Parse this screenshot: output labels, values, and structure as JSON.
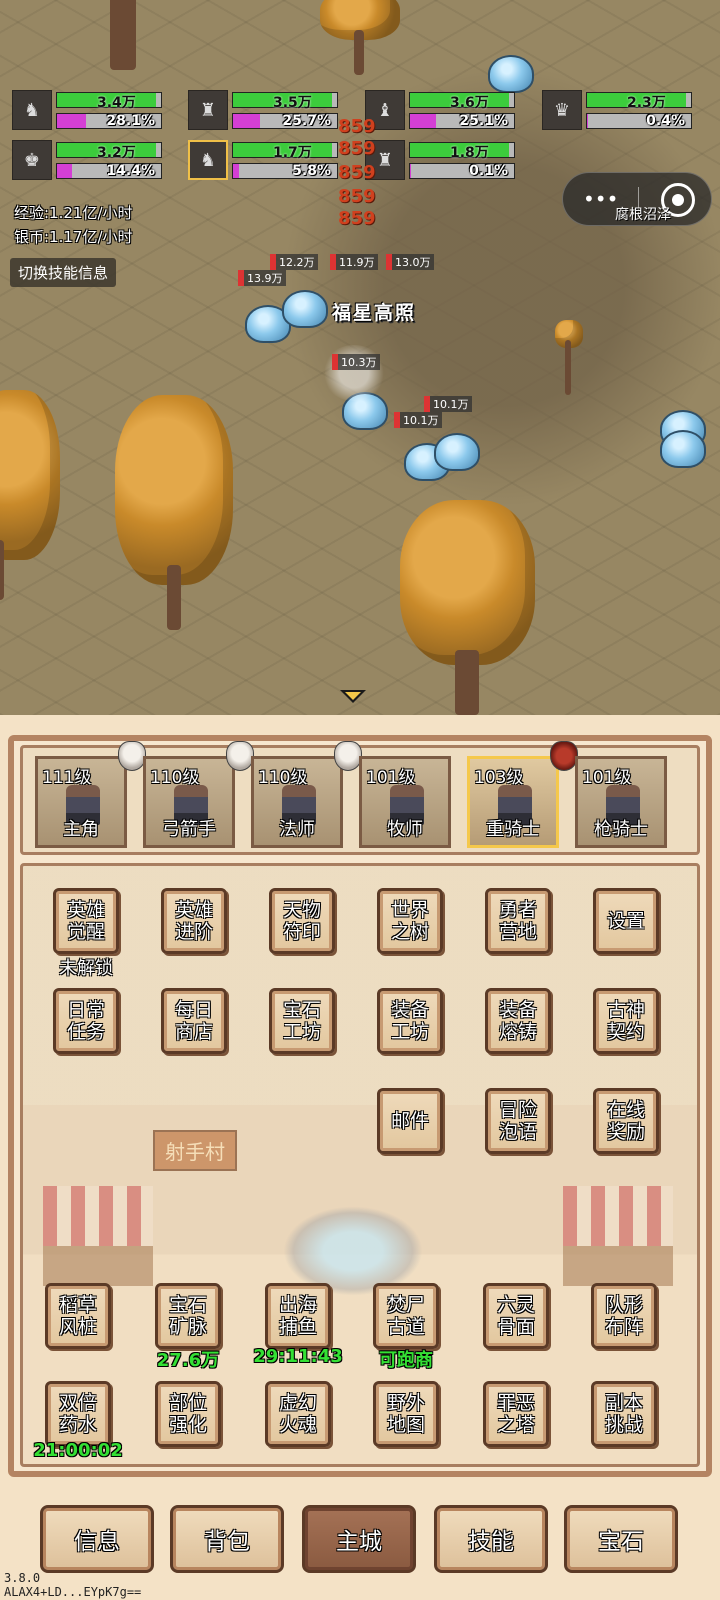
{
  "party": [
    {
      "hp": "3.4万",
      "xp": "28.1%",
      "hp_fill": 0.95,
      "xp_fill": 0.28,
      "selected": false
    },
    {
      "hp": "3.5万",
      "xp": "25.7%",
      "hp_fill": 0.95,
      "xp_fill": 0.26,
      "selected": false
    },
    {
      "hp": "3.6万",
      "xp": "25.1%",
      "hp_fill": 0.95,
      "xp_fill": 0.25,
      "selected": false
    },
    {
      "hp": "2.3万",
      "xp": "0.4%",
      "hp_fill": 0.95,
      "xp_fill": 0.01,
      "selected": false
    },
    {
      "hp": "3.2万",
      "xp": "14.4%",
      "hp_fill": 0.95,
      "xp_fill": 0.14,
      "selected": false
    },
    {
      "hp": "1.7万",
      "xp": "5.8%",
      "hp_fill": 0.95,
      "xp_fill": 0.06,
      "selected": true
    },
    {
      "hp": "1.8万",
      "xp": "0.1%",
      "hp_fill": 0.95,
      "xp_fill": 0.01,
      "selected": false
    }
  ],
  "stats": {
    "exp_rate": "经验:1.21亿/小时",
    "silver_rate": "银币:1.17亿/小时",
    "toggle_skill": "切换技能信息"
  },
  "capsule": {
    "dots": "•••",
    "map_name": "腐根沼泽"
  },
  "battle": {
    "buff_text": "福星高照",
    "crits": [
      "859",
      "859",
      "859",
      "859",
      "859"
    ],
    "damage_numbers": [
      "12.2万",
      "11.9万",
      "13.0万",
      "13.9万",
      "10.3万",
      "10.1万",
      "10.1万"
    ]
  },
  "heroes": [
    {
      "level": "111级",
      "name": "主角",
      "selected": false
    },
    {
      "level": "110级",
      "name": "弓箭手",
      "selected": false
    },
    {
      "level": "110级",
      "name": "法师",
      "selected": false
    },
    {
      "level": "101级",
      "name": "牧师",
      "selected": false
    },
    {
      "level": "103级",
      "name": "重骑士",
      "selected": true
    },
    {
      "level": "101级",
      "name": "枪骑士",
      "selected": false
    }
  ],
  "menu": {
    "hero_awaken": "英雄\n觉醒",
    "hero_awaken_status": "未解锁",
    "hero_advance": "英雄\n进阶",
    "artifact_seal": "天物\n符印",
    "world_tree": "世界\n之树",
    "brave_camp": "勇者\n营地",
    "settings": "设置",
    "daily_tasks": "日常\n任务",
    "daily_shop": "每日\n商店",
    "gem_workshop": "宝石\n工坊",
    "equip_workshop": "装备\n工坊",
    "equip_forge": "装备\n熔铸",
    "ancient_pact": "古神\n契约",
    "mail": "邮件",
    "adventure_bubble": "冒险\n泡语",
    "online_reward": "在线\n奖励",
    "town_sign": "射手村",
    "scarecrow": "稻草\n风桩",
    "gem_mine": "宝石\n矿脉",
    "gem_mine_value": "27.6万",
    "sea_fishing": "出海\n捕鱼",
    "sea_fishing_timer": "29:11:43",
    "corpse_road": "焚尸\n古道",
    "corpse_road_status": "可跑商",
    "six_spirit_mask": "六灵\n骨面",
    "formation": "队形\n布阵",
    "double_potion": "双倍\n药水",
    "double_potion_timer": "21:00:02",
    "part_enhance": "部位\n强化",
    "phantom_soul": "虚幻\n火魂",
    "field_map": "野外\n地图",
    "evil_tower": "罪恶\n之塔",
    "dungeon": "副本\n挑战"
  },
  "tabs": [
    {
      "label": "信息",
      "active": false
    },
    {
      "label": "背包",
      "active": false
    },
    {
      "label": "主城",
      "active": true
    },
    {
      "label": "技能",
      "active": false
    },
    {
      "label": "宝石",
      "active": false
    }
  ],
  "version": {
    "number": "3.8.0",
    "id": "ALAX4+LD...EYpK7g=="
  },
  "colors": {
    "hp_bar": "#3ccc3c",
    "xp_bar": "#d43fd4",
    "panel_border": "#b48462",
    "button_border": "#5b3a26",
    "timer_green": "#34e034",
    "crit_red": "#d0401e"
  }
}
